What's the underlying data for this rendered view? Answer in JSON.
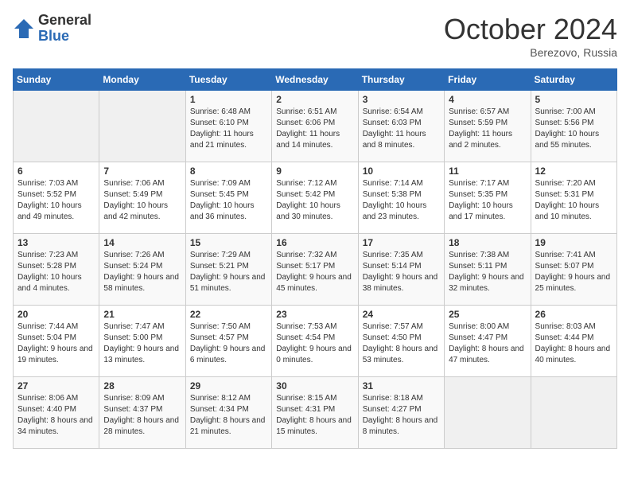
{
  "header": {
    "logo_general": "General",
    "logo_blue": "Blue",
    "month_title": "October 2024",
    "location": "Berezovo, Russia"
  },
  "weekdays": [
    "Sunday",
    "Monday",
    "Tuesday",
    "Wednesday",
    "Thursday",
    "Friday",
    "Saturday"
  ],
  "weeks": [
    [
      {
        "day": "",
        "info": ""
      },
      {
        "day": "",
        "info": ""
      },
      {
        "day": "1",
        "info": "Sunrise: 6:48 AM\nSunset: 6:10 PM\nDaylight: 11 hours and 21 minutes."
      },
      {
        "day": "2",
        "info": "Sunrise: 6:51 AM\nSunset: 6:06 PM\nDaylight: 11 hours and 14 minutes."
      },
      {
        "day": "3",
        "info": "Sunrise: 6:54 AM\nSunset: 6:03 PM\nDaylight: 11 hours and 8 minutes."
      },
      {
        "day": "4",
        "info": "Sunrise: 6:57 AM\nSunset: 5:59 PM\nDaylight: 11 hours and 2 minutes."
      },
      {
        "day": "5",
        "info": "Sunrise: 7:00 AM\nSunset: 5:56 PM\nDaylight: 10 hours and 55 minutes."
      }
    ],
    [
      {
        "day": "6",
        "info": "Sunrise: 7:03 AM\nSunset: 5:52 PM\nDaylight: 10 hours and 49 minutes."
      },
      {
        "day": "7",
        "info": "Sunrise: 7:06 AM\nSunset: 5:49 PM\nDaylight: 10 hours and 42 minutes."
      },
      {
        "day": "8",
        "info": "Sunrise: 7:09 AM\nSunset: 5:45 PM\nDaylight: 10 hours and 36 minutes."
      },
      {
        "day": "9",
        "info": "Sunrise: 7:12 AM\nSunset: 5:42 PM\nDaylight: 10 hours and 30 minutes."
      },
      {
        "day": "10",
        "info": "Sunrise: 7:14 AM\nSunset: 5:38 PM\nDaylight: 10 hours and 23 minutes."
      },
      {
        "day": "11",
        "info": "Sunrise: 7:17 AM\nSunset: 5:35 PM\nDaylight: 10 hours and 17 minutes."
      },
      {
        "day": "12",
        "info": "Sunrise: 7:20 AM\nSunset: 5:31 PM\nDaylight: 10 hours and 10 minutes."
      }
    ],
    [
      {
        "day": "13",
        "info": "Sunrise: 7:23 AM\nSunset: 5:28 PM\nDaylight: 10 hours and 4 minutes."
      },
      {
        "day": "14",
        "info": "Sunrise: 7:26 AM\nSunset: 5:24 PM\nDaylight: 9 hours and 58 minutes."
      },
      {
        "day": "15",
        "info": "Sunrise: 7:29 AM\nSunset: 5:21 PM\nDaylight: 9 hours and 51 minutes."
      },
      {
        "day": "16",
        "info": "Sunrise: 7:32 AM\nSunset: 5:17 PM\nDaylight: 9 hours and 45 minutes."
      },
      {
        "day": "17",
        "info": "Sunrise: 7:35 AM\nSunset: 5:14 PM\nDaylight: 9 hours and 38 minutes."
      },
      {
        "day": "18",
        "info": "Sunrise: 7:38 AM\nSunset: 5:11 PM\nDaylight: 9 hours and 32 minutes."
      },
      {
        "day": "19",
        "info": "Sunrise: 7:41 AM\nSunset: 5:07 PM\nDaylight: 9 hours and 25 minutes."
      }
    ],
    [
      {
        "day": "20",
        "info": "Sunrise: 7:44 AM\nSunset: 5:04 PM\nDaylight: 9 hours and 19 minutes."
      },
      {
        "day": "21",
        "info": "Sunrise: 7:47 AM\nSunset: 5:00 PM\nDaylight: 9 hours and 13 minutes."
      },
      {
        "day": "22",
        "info": "Sunrise: 7:50 AM\nSunset: 4:57 PM\nDaylight: 9 hours and 6 minutes."
      },
      {
        "day": "23",
        "info": "Sunrise: 7:53 AM\nSunset: 4:54 PM\nDaylight: 9 hours and 0 minutes."
      },
      {
        "day": "24",
        "info": "Sunrise: 7:57 AM\nSunset: 4:50 PM\nDaylight: 8 hours and 53 minutes."
      },
      {
        "day": "25",
        "info": "Sunrise: 8:00 AM\nSunset: 4:47 PM\nDaylight: 8 hours and 47 minutes."
      },
      {
        "day": "26",
        "info": "Sunrise: 8:03 AM\nSunset: 4:44 PM\nDaylight: 8 hours and 40 minutes."
      }
    ],
    [
      {
        "day": "27",
        "info": "Sunrise: 8:06 AM\nSunset: 4:40 PM\nDaylight: 8 hours and 34 minutes."
      },
      {
        "day": "28",
        "info": "Sunrise: 8:09 AM\nSunset: 4:37 PM\nDaylight: 8 hours and 28 minutes."
      },
      {
        "day": "29",
        "info": "Sunrise: 8:12 AM\nSunset: 4:34 PM\nDaylight: 8 hours and 21 minutes."
      },
      {
        "day": "30",
        "info": "Sunrise: 8:15 AM\nSunset: 4:31 PM\nDaylight: 8 hours and 15 minutes."
      },
      {
        "day": "31",
        "info": "Sunrise: 8:18 AM\nSunset: 4:27 PM\nDaylight: 8 hours and 8 minutes."
      },
      {
        "day": "",
        "info": ""
      },
      {
        "day": "",
        "info": ""
      }
    ]
  ]
}
